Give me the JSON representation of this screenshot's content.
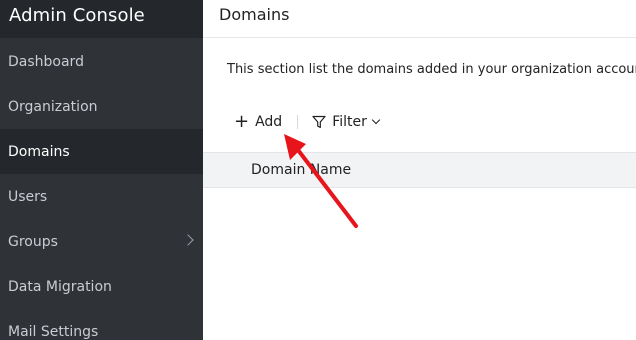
{
  "sidebar": {
    "title": "Admin Console",
    "items": [
      {
        "label": "Dashboard"
      },
      {
        "label": "Organization"
      },
      {
        "label": "Domains",
        "active": true
      },
      {
        "label": "Users"
      },
      {
        "label": "Groups",
        "has_children": true
      },
      {
        "label": "Data Migration"
      },
      {
        "label": "Mail Settings"
      }
    ]
  },
  "main": {
    "title": "Domains",
    "description": "This section list the domains added in your organization account.",
    "toolbar": {
      "add_label": "Add",
      "filter_label": "Filter"
    },
    "table": {
      "columns": [
        "Domain Name"
      ]
    }
  },
  "colors": {
    "sidebar_bg": "#2f3338",
    "sidebar_active_bg": "#24282c",
    "annotation_arrow": "#e8141b"
  },
  "icons": [
    "plus-icon",
    "filter-icon",
    "chevron-down-icon",
    "chevron-right-icon"
  ]
}
